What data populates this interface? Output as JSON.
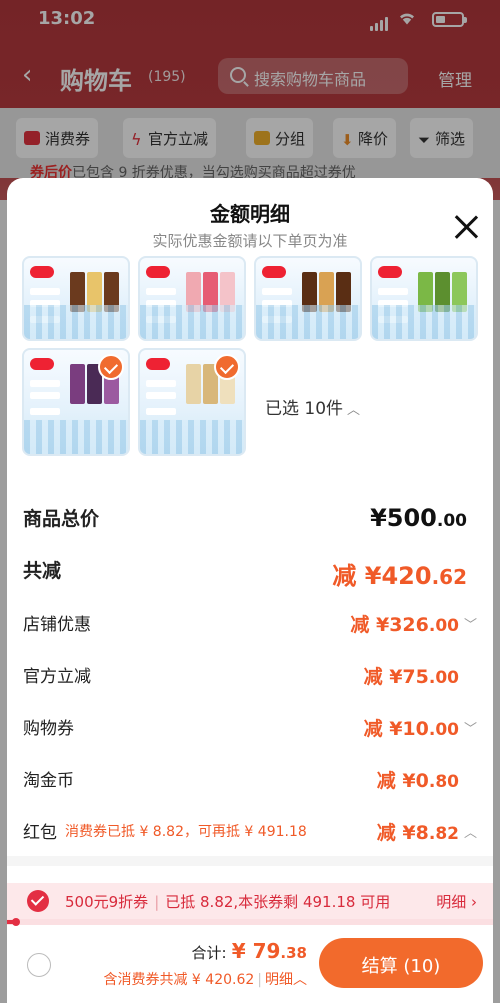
{
  "status_bar": {
    "time": "13:02"
  },
  "header": {
    "back": "‹",
    "title": "购物车",
    "count": "(195)",
    "search_placeholder": "搜索购物车商品",
    "manage": "管理"
  },
  "filters": [
    {
      "label": "消费券",
      "icon": "coupon-icon",
      "color": "#e3343f"
    },
    {
      "label": "官方立减",
      "icon": "lightning-icon",
      "color": "#e3343f"
    },
    {
      "label": "分组",
      "icon": "folder-icon",
      "color": "#f2b12b"
    },
    {
      "label": "降价",
      "icon": "down-arrow-icon",
      "color": "#f0902a"
    },
    {
      "label": "筛选",
      "icon": "filter-icon",
      "color": "#333333"
    }
  ],
  "peek_text": {
    "red": "券后价",
    "rest": "已包含 9 折券优惠，当勾选购买商品超过券优"
  },
  "sheet": {
    "title": "金额明细",
    "subtitle": "实际优惠金额请以下单页为准",
    "selected_text": "已选 10件",
    "items": [
      {
        "variant": "chocolate",
        "colors": [
          "#6b3a1e",
          "#e8c46a",
          "#6b3a1e"
        ],
        "checked": false
      },
      {
        "variant": "strawberry",
        "colors": [
          "#f0a9b1",
          "#e65c74",
          "#f4c3c9"
        ],
        "checked": false
      },
      {
        "variant": "chocolate-max",
        "colors": [
          "#5a2e14",
          "#d9a253",
          "#5a2e14"
        ],
        "checked": false
      },
      {
        "variant": "matcha",
        "colors": [
          "#7bb846",
          "#5c8f2f",
          "#8cc75b"
        ],
        "checked": false
      },
      {
        "variant": "purple",
        "colors": [
          "#7a3d7f",
          "#4a2a55",
          "#9b5aa0"
        ],
        "checked": true
      },
      {
        "variant": "vanilla",
        "colors": [
          "#e7d3a6",
          "#d8b77a",
          "#efe0bd"
        ],
        "checked": true
      }
    ],
    "rows": [
      {
        "label": "商品总价",
        "prefix": "",
        "value": "¥500",
        "dec": ".00",
        "style": "total",
        "arrow": ""
      },
      {
        "label": "共减",
        "prefix": "减 ",
        "value": "¥420",
        "dec": ".62",
        "style": "big",
        "arrow": ""
      },
      {
        "label": "店铺优惠",
        "prefix": "减 ",
        "value": "¥326",
        "dec": ".00",
        "style": "normal",
        "arrow": "﹀"
      },
      {
        "label": "官方立减",
        "prefix": "减 ",
        "value": "¥75",
        "dec": ".00",
        "style": "normal",
        "arrow": ""
      },
      {
        "label": "购物券",
        "prefix": "减 ",
        "value": "¥10",
        "dec": ".00",
        "style": "normal",
        "arrow": "﹀"
      },
      {
        "label": "淘金币",
        "prefix": "减 ",
        "value": "¥0",
        "dec": ".80",
        "style": "normal",
        "arrow": ""
      },
      {
        "label": "红包",
        "note": "消费券已抵 ¥ 8.82，可再抵 ¥ 491.18",
        "prefix": "减 ",
        "value": "¥8",
        "dec": ".82",
        "style": "normal",
        "arrow": "︿"
      }
    ]
  },
  "coupon_bar": {
    "left": "500元9折券",
    "right": "已抵 8.82,本张券剩 491.18 可用",
    "detail": "明细 ›",
    "progress": 0.018
  },
  "bottom_bar": {
    "total_label": "合计:",
    "total_int": "¥ 79",
    "total_dec": ".38",
    "subline": "含消费券共减 ¥ 420.62",
    "detail": "明细︿",
    "button": "结算 (10)"
  }
}
